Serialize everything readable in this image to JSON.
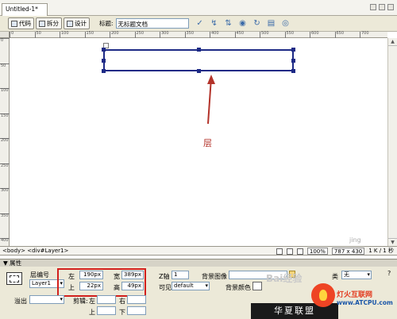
{
  "document_tab": {
    "title": "Untitled-1*"
  },
  "toolbar": {
    "code_label": "代码",
    "split_label": "拆分",
    "design_label": "设计",
    "title_label": "标题:",
    "title_value": "无标题文档",
    "icons": [
      "validate-icon",
      "browser-check-icon",
      "file-management-icon",
      "preview-icon",
      "refresh-icon",
      "view-options-icon",
      "visual-aids-icon"
    ]
  },
  "ruler": {
    "h_ticks": [
      "0",
      "50",
      "100",
      "150",
      "200",
      "250",
      "300",
      "350",
      "400",
      "450",
      "500",
      "550",
      "600",
      "650",
      "700"
    ],
    "v_ticks": [
      "0",
      "50",
      "100",
      "150",
      "200",
      "250",
      "300",
      "350",
      "400"
    ]
  },
  "canvas": {
    "callout_text": "层"
  },
  "status_bar": {
    "tag_path": "<body> <div#Layer1>",
    "zoom": "100%",
    "dimensions": "787 x 430",
    "file_info": "1 K / 1 秒"
  },
  "properties": {
    "panel_title": "属性",
    "layer_id_label": "层编号",
    "layer_id_value": "Layer1",
    "left_label": "左",
    "left_value": "190px",
    "top_label": "上",
    "top_value": "22px",
    "width_label": "宽",
    "width_value": "389px",
    "height_label": "高",
    "height_value": "49px",
    "z_label": "Z轴",
    "z_value": "1",
    "bg_image_label": "背景图像",
    "visibility_label": "可见性",
    "visibility_value": "default",
    "bg_color_label": "背景颜色",
    "overflow_label": "溢出",
    "clip_label": "剪辑:",
    "clip_left_label": "左",
    "clip_right_label": "右",
    "clip_top_label": "上",
    "clip_bottom_label": "下",
    "class_label": "类",
    "class_value": "无"
  },
  "watermark": {
    "site_cn": "华夏联盟",
    "site_title": "灯火互联网",
    "site_url": "www.ATCPU.com",
    "baidu_mark": "Bai经验",
    "jing_mark": "jing"
  },
  "colors": {
    "layer_border": "#1d2a86",
    "callout": "#b3332a",
    "highlight": "#d2201d"
  }
}
